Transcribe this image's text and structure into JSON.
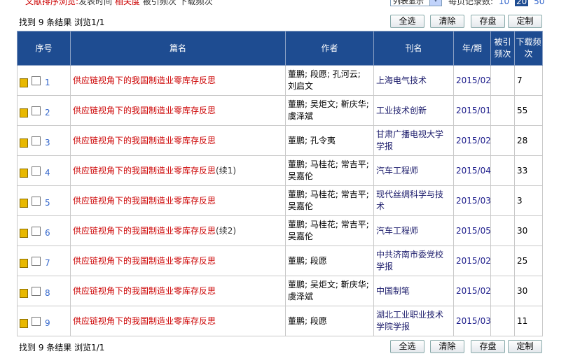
{
  "top": {
    "sort_label": "文献排序浏览:",
    "sort_options": [
      "发表时间",
      "相关度",
      "被引频次",
      "下载频次"
    ],
    "active_sort": "相关度",
    "view_mode": "列表显示",
    "per_page_label": "每页记录数:",
    "per_page_options": [
      "10",
      "20",
      "50"
    ],
    "per_page_selected": "20"
  },
  "toolbar": {
    "result_info": "找到 9 条结果  浏览1/1",
    "select_all": "全选",
    "clear": "清除",
    "save": "存盘",
    "custom": "定制"
  },
  "table": {
    "headers": [
      "序号",
      "篇名",
      "作者",
      "刊名",
      "年/期",
      "被引频次",
      "下载频次"
    ],
    "rows": [
      {
        "no": "1",
        "title": "供应链视角下的我国制造业零库存反思",
        "suffix": "",
        "authors": "董鹏; 段愿; 孔河云; 刘启文",
        "journal": "上海电气技术",
        "date": "2015/02",
        "cited": "",
        "downloads": "7"
      },
      {
        "no": "2",
        "title": "供应链视角下的我国制造业零库存反思",
        "suffix": "",
        "authors": "董鹏; 吴炬文; 靳庆华; 虞泽斌",
        "journal": "工业技术创新",
        "date": "2015/01",
        "cited": "",
        "downloads": "55"
      },
      {
        "no": "3",
        "title": "供应链视角下的我国制造业零库存反思",
        "suffix": "",
        "authors": "董鹏; 孔令夷",
        "journal": "甘肃广播电视大学学报",
        "date": "2015/02",
        "cited": "",
        "downloads": "28"
      },
      {
        "no": "4",
        "title": "供应链视角下的我国制造业零库存反思",
        "suffix": "(续1)",
        "authors": "董鹏; 马桂花; 常吉平; 吴嘉伦",
        "journal": "汽车工程师",
        "date": "2015/04",
        "cited": "",
        "downloads": "33"
      },
      {
        "no": "5",
        "title": "供应链视角下的我国制造业零库存反思",
        "suffix": "",
        "authors": "董鹏; 马桂花; 常吉平; 吴嘉伦",
        "journal": "现代丝绸科学与技术",
        "date": "2015/03",
        "cited": "",
        "downloads": "3"
      },
      {
        "no": "6",
        "title": "供应链视角下的我国制造业零库存反思",
        "suffix": "(续2)",
        "authors": "董鹏; 马桂花; 常吉平; 吴嘉伦",
        "journal": "汽车工程师",
        "date": "2015/05",
        "cited": "",
        "downloads": "30"
      },
      {
        "no": "7",
        "title": "供应链视角下的我国制造业零库存反思",
        "suffix": "",
        "authors": "董鹏; 段愿",
        "journal": "中共济南市委党校学报",
        "date": "2015/02",
        "cited": "",
        "downloads": "25"
      },
      {
        "no": "8",
        "title": "供应链视角下的我国制造业零库存反思",
        "suffix": "",
        "authors": "董鹏; 吴炬文; 靳庆华; 虞泽斌",
        "journal": "中国制笔",
        "date": "2015/02",
        "cited": "",
        "downloads": "30"
      },
      {
        "no": "9",
        "title": "供应链视角下的我国制造业零库存反思",
        "suffix": "",
        "authors": "董鹏; 段愿",
        "journal": "湖北工业职业技术学院学报",
        "date": "2015/03",
        "cited": "",
        "downloads": "11"
      }
    ]
  }
}
